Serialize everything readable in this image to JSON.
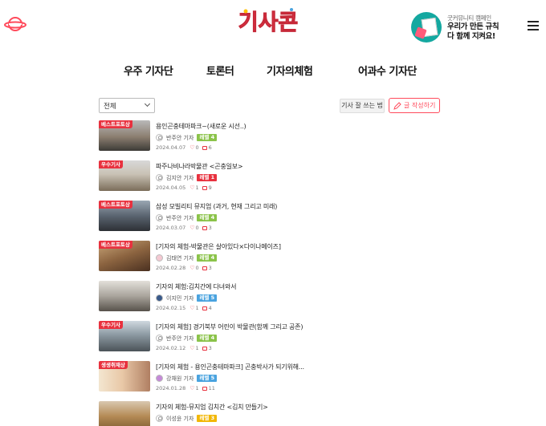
{
  "header": {
    "logo_text": "기사콘",
    "campaign": {
      "kicker": "굿커뮤니티 캠페인",
      "line1": "우리가 만든 규칙",
      "line2": "다 함께 지켜요!"
    }
  },
  "tabs": [
    {
      "label": "우주 기자단"
    },
    {
      "label": "토론터"
    },
    {
      "label": "기자의체험"
    },
    {
      "label": "어과수 기자단"
    }
  ],
  "filter": {
    "selected": "전체"
  },
  "toolbar": {
    "guide_label": "기사 잘 쓰는 법",
    "write_label": "글 작성하기"
  },
  "colors": {
    "accent": "#ff4b5c",
    "ribbon": "#e8323f",
    "grade4": "#8bc34a",
    "grade1": "#e8323f",
    "grade5": "#4aa3df",
    "grade3": "#f2b705"
  },
  "posts": [
    {
      "badge": "베스트포토상",
      "title": "용인곤충테마파크~(새로운 시선..)",
      "author": "반주안 기자",
      "grade": "레벨 4",
      "date": "2024.04.07",
      "likes": "0",
      "comments": "6"
    },
    {
      "badge": "우수기사",
      "title": "파주나비나라박물관 <곤충일보>",
      "author": "김지안 기자",
      "grade": "레벨 1",
      "date": "2024.04.05",
      "likes": "1",
      "comments": "9"
    },
    {
      "badge": "베스트포토상",
      "title": "삼성 모빌리티 뮤지엄 (과거, 현재 그리고 미래)",
      "author": "반주안 기자",
      "grade": "레벨 4",
      "date": "2024.03.07",
      "likes": "0",
      "comments": "3"
    },
    {
      "badge": "베스트포토상",
      "title": "[기자의 체험-박물관은 살아있다×다이나메이즈]",
      "author": "김태연 기자",
      "grade": "레벨 4",
      "date": "2024.02.28",
      "likes": "0",
      "comments": "3"
    },
    {
      "badge": "",
      "title": "기자의 체험:김치간에 다녀와서",
      "author": "이지민 기자",
      "grade": "레벨 5",
      "date": "2024.02.15",
      "likes": "1",
      "comments": "4"
    },
    {
      "badge": "우수기사",
      "title": "[기자의 체험] 경기북부 어린이 박물관(함께 그리고 공존)",
      "author": "반주안 기자",
      "grade": "레벨 4",
      "date": "2024.02.12",
      "likes": "1",
      "comments": "3"
    },
    {
      "badge": "생생취재상",
      "title": "[기자의 체험 - 용인곤충테마파크] 곤충박사가 되기위해...",
      "author": "강채원 기자",
      "grade": "레벨 5",
      "date": "2024.01.28",
      "likes": "1",
      "comments": "11"
    },
    {
      "badge": "",
      "title": "기자의 체험-뮤지엄 김치간 <김치 만들기>",
      "author": "이성윤 기자",
      "grade": "레벨 3",
      "date": "",
      "likes": "",
      "comments": ""
    }
  ]
}
